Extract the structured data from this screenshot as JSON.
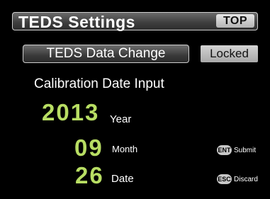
{
  "header": {
    "title": "TEDS Settings",
    "top_label": "TOP"
  },
  "controls": {
    "change_label": "TEDS Data Change",
    "status_label": "Locked"
  },
  "form": {
    "heading": "Calibration Date Input",
    "year": {
      "value": "2013",
      "unit": "Year"
    },
    "month": {
      "value": "09",
      "unit": "Month"
    },
    "date": {
      "value": "26",
      "unit": "Date"
    }
  },
  "keys": {
    "submit": {
      "icon": "ENT",
      "label": "Submit"
    },
    "discard": {
      "icon": "ESC",
      "label": "Discard"
    }
  },
  "colors": {
    "value_green": "#b8de63",
    "background": "#000000"
  }
}
